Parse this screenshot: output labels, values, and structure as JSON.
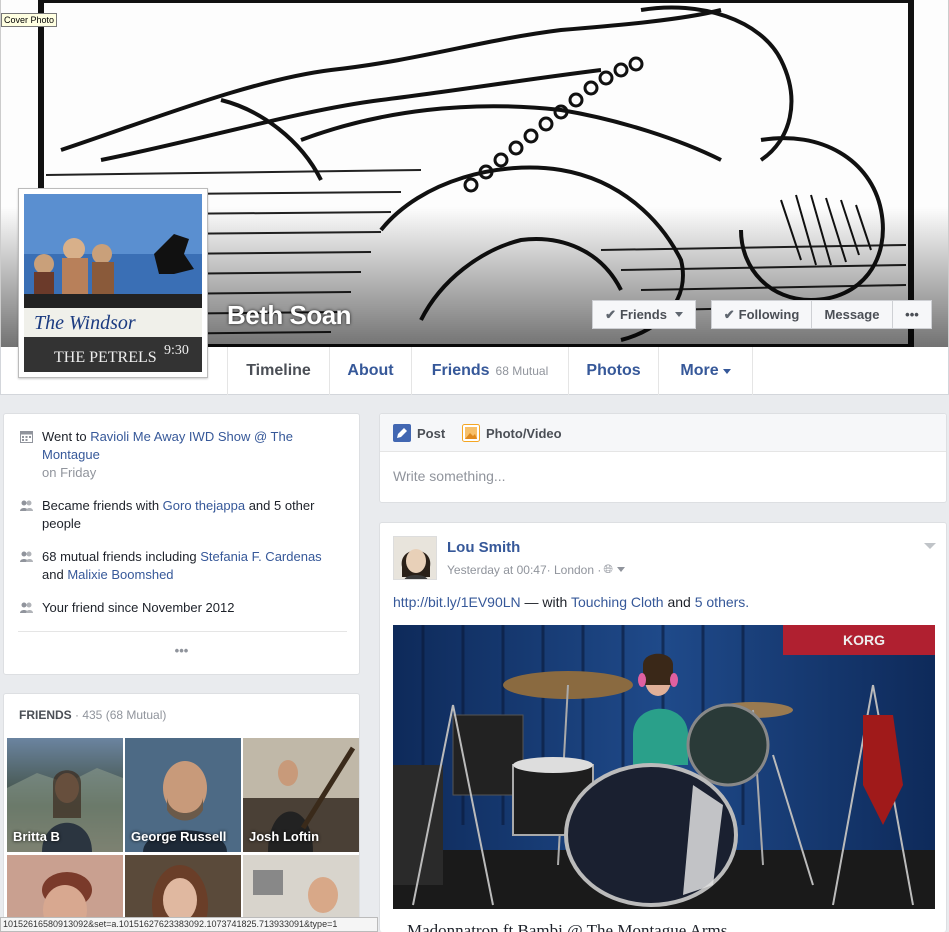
{
  "cover": {
    "tooltip": "Cover Photo",
    "name": "Beth Soan",
    "buttons": {
      "friends": "Friends",
      "following": "Following",
      "message": "Message",
      "more_dots": "•••"
    }
  },
  "profile_pic": {
    "sign_text_1": "The Windsor",
    "sign_text_2": "THE PETRELS",
    "sign_text_3": "9:30"
  },
  "nav": {
    "tabs": [
      {
        "label": "Timeline"
      },
      {
        "label": "About"
      },
      {
        "label": "Friends",
        "sub": "68 Mutual"
      },
      {
        "label": "Photos"
      },
      {
        "label": "More"
      }
    ]
  },
  "activity": {
    "item1": {
      "pre": "Went to ",
      "link": "Ravioli Me Away IWD Show @ The Montague",
      "sub": "on Friday"
    },
    "item2": {
      "pre": "Became friends with ",
      "link": "Goro thejappa",
      "post": " and 5 other people"
    },
    "item3": {
      "pre": "68 mutual friends including ",
      "link1": "Stefania F. Cardenas",
      "mid": " and ",
      "link2": "Malixie Boomshed"
    },
    "item4": {
      "text": "Your friend since November 2012"
    },
    "more": "•••"
  },
  "friends_box": {
    "title": "FRIENDS",
    "count": " · 435 (68 Mutual)",
    "tiles": [
      {
        "name": "Britta B"
      },
      {
        "name": "George Russell"
      },
      {
        "name": "Josh Loftin"
      },
      {
        "name": ""
      },
      {
        "name": ""
      },
      {
        "name": ""
      }
    ]
  },
  "composer": {
    "post_label": "Post",
    "photo_label": "Photo/Video",
    "placeholder": "Write something..."
  },
  "post": {
    "author": "Lou Smith",
    "time": "Yesterday at 00:47",
    "location": " · London · ",
    "link": "http://bit.ly/1EV90LN",
    "with_text": " — with ",
    "tagged": "Touching Cloth",
    "and_text": " and ",
    "others": "5 others.",
    "photo_brand": "KORG",
    "caption": "Madonnatron ft Bambi @ The Montague Arms"
  },
  "status_bar": {
    "url": "10152616580913092&set=a.10151627623383092.1073741825.713933091&type=1"
  },
  "colors": {
    "link": "#365899",
    "page_bg": "#e9ebee"
  }
}
